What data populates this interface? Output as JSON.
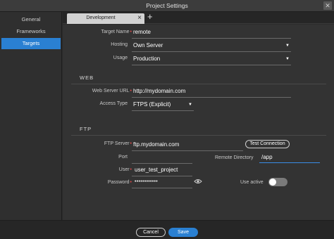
{
  "window": {
    "title": "Project Settings"
  },
  "sidebar": {
    "items": [
      {
        "label": "General"
      },
      {
        "label": "Frameworks"
      },
      {
        "label": "Targets"
      }
    ]
  },
  "tabs": [
    {
      "label": "Development"
    }
  ],
  "target": {
    "name_label": "Target Name",
    "name_value": "remote",
    "hosting_label": "Hosting",
    "hosting_value": "Own Server",
    "usage_label": "Usage",
    "usage_value": "Production"
  },
  "web": {
    "section_title": "WEB",
    "url_label": "Web Server URL",
    "url_value": "http://mydomain.com",
    "access_label": "Access Type",
    "access_value": "FTPS (Explicit)"
  },
  "ftp": {
    "section_title": "FTP",
    "server_label": "FTP Server",
    "server_value": "ftp.mydomain.com",
    "test_button": "Test Connection",
    "port_label": "Port",
    "port_value": "",
    "remote_dir_label": "Remote Directory",
    "remote_dir_value": "/app",
    "user_label": "User",
    "user_value": "user_test_project",
    "password_label": "Password",
    "password_value": "••••••••••••",
    "use_active_label": "Use active",
    "use_active": false
  },
  "footer": {
    "cancel_label": "Cancel",
    "save_label": "Save"
  },
  "icons": {
    "close": "close-icon",
    "add": "plus-icon",
    "eye": "eye-icon",
    "caret": "caret-down-icon"
  },
  "colors": {
    "accent": "#2a80d2",
    "required": "#e04848"
  }
}
